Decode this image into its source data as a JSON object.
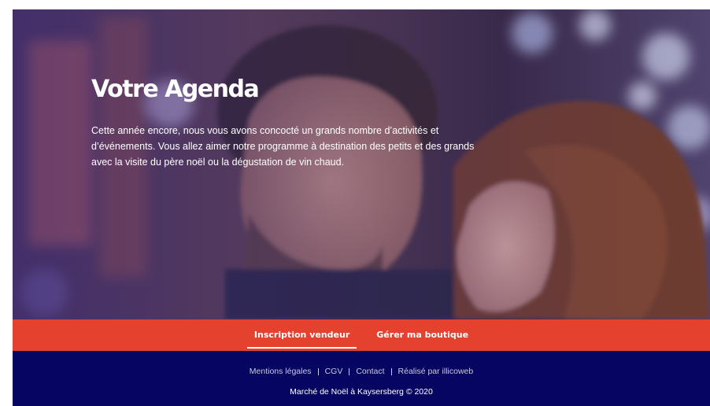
{
  "hero": {
    "title": "Votre Agenda",
    "text": "Cette année encore, nous vous avons concocté un grands nombre d’activités et d’événements. Vous allez aimer notre programme à destination des petits et des grands avec la visite du père noël ou la dégustation de vin chaud.",
    "image": "couple-christmas-market-photo"
  },
  "actions": {
    "signup_label": "Inscription vendeur",
    "manage_label": "Gérer ma boutique"
  },
  "footer": {
    "links": {
      "legal": "Mentions légales",
      "cgv": "CGV",
      "contact": "Contact",
      "credit": "Réalisé par illicoweb"
    },
    "copyright": "Marché de Noël à Kaysersberg © 2020"
  },
  "colors": {
    "accent": "#e4412f",
    "footer_bg": "#060561",
    "hero_tint": "#30227a"
  }
}
